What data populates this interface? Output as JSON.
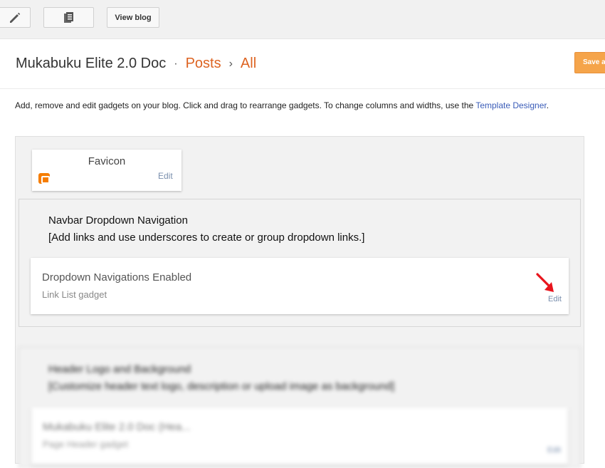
{
  "toolbar": {
    "edit_icon": "pencil-icon",
    "pages_icon": "pages-icon",
    "view_blog_label": "View blog"
  },
  "header": {
    "blog_title": "Mukabuku Elite 2.0 Doc",
    "separator": "·",
    "posts_link": "Posts",
    "arrow": "›",
    "all_link": "All",
    "save_label": "Save arrangement"
  },
  "intro": {
    "text": "Add, remove and edit gadgets on your blog. Click and drag to rearrange gadgets. To change columns and widths, use the ",
    "template_link": "Template Designer",
    "end": "."
  },
  "favicon": {
    "title": "Favicon",
    "edit": "Edit"
  },
  "navbar_section": {
    "title_line1": "Navbar Dropdown Navigation",
    "title_line2": "[Add links and use underscores to create or group dropdown links.]",
    "gadget_name": "Dropdown Navigations Enabled",
    "gadget_type": "Link List gadget",
    "edit": "Edit"
  },
  "header_section": {
    "title_line1": "Header Logo and Background",
    "title_line2": "[Customize header text logo, description or upload image as background]",
    "gadget_name": "Mukabuku Elite 2.0 Doc (Hea...",
    "gadget_type": "Page Header gadget",
    "edit": "Edit"
  },
  "colors": {
    "accent_orange": "#dd6321",
    "save_button": "#f5a44a",
    "link_blue": "#3a5cb8",
    "arrow_red": "#e8141c"
  }
}
